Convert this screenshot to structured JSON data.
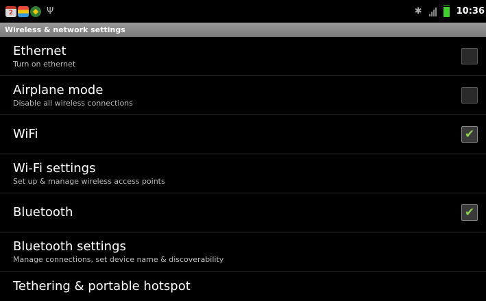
{
  "status_bar": {
    "time": "10:36",
    "calendar_badge": "2",
    "icons": [
      "calendar-notification-icon",
      "notes-notification-icon",
      "market-notification-icon",
      "usb-icon",
      "bluetooth-icon",
      "signal-icon",
      "battery-icon"
    ]
  },
  "header": {
    "title": "Wireless & network settings"
  },
  "items": [
    {
      "title": "Ethernet",
      "summary": "Turn on ethernet",
      "checkbox": true,
      "checked": false
    },
    {
      "title": "Airplane mode",
      "summary": "Disable all wireless connections",
      "checkbox": true,
      "checked": false
    },
    {
      "title": "WiFi",
      "summary": "",
      "checkbox": true,
      "checked": true
    },
    {
      "title": "Wi-Fi settings",
      "summary": "Set up & manage wireless access points",
      "checkbox": false
    },
    {
      "title": "Bluetooth",
      "summary": "",
      "checkbox": true,
      "checked": true
    },
    {
      "title": "Bluetooth settings",
      "summary": "Manage connections, set device name & discoverability",
      "checkbox": false
    },
    {
      "title": "Tethering & portable hotspot",
      "summary": "",
      "checkbox": false
    }
  ],
  "colors": {
    "background": "#000000",
    "title_bar": "#8a8a8a",
    "check": "#8fd14f",
    "battery": "#3ecf2a"
  }
}
